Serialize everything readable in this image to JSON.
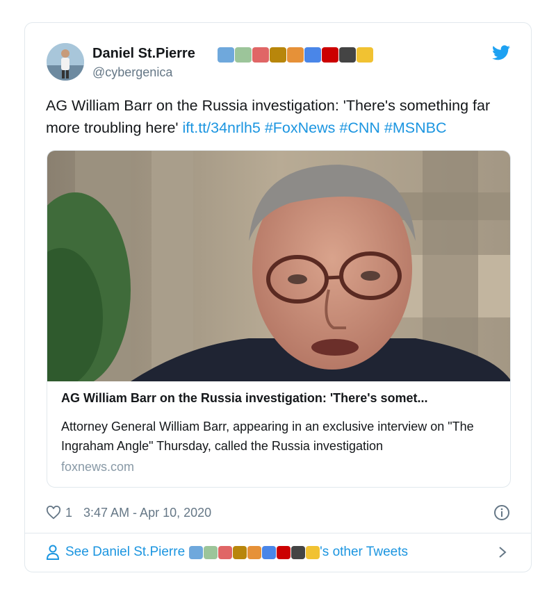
{
  "tweet": {
    "author_name": "Daniel St.Pierre",
    "author_emojis": [
      "open-book",
      "dragonfly",
      "airplane",
      "farmer",
      "beach-umbrella",
      "diver",
      "canada-flag",
      "hockey-stick",
      "beer-mug"
    ],
    "handle": "@cybergenica",
    "text_plain": "AG William Barr on the Russia investigation: 'There's something far more troubling here' ",
    "links": [
      "ift.tt/34nrlh5",
      "#FoxNews",
      "#CNN",
      "#MSNBC"
    ],
    "likes": "1",
    "timestamp": "3:47 AM - Apr 10, 2020"
  },
  "embed": {
    "title": "AG William Barr on the Russia investigation: 'There's somet...",
    "description": "Attorney General William Barr, appearing in an exclusive interview on \"The Ingraham Angle\" Thursday, called the Russia investigation",
    "domain": "foxnews.com"
  },
  "footer": {
    "prefix": "See Daniel St.Pierre",
    "suffix": "'s other Tweets"
  },
  "colors": {
    "link": "#1b95e0",
    "muted": "#657786",
    "border": "#e1e8ed"
  }
}
